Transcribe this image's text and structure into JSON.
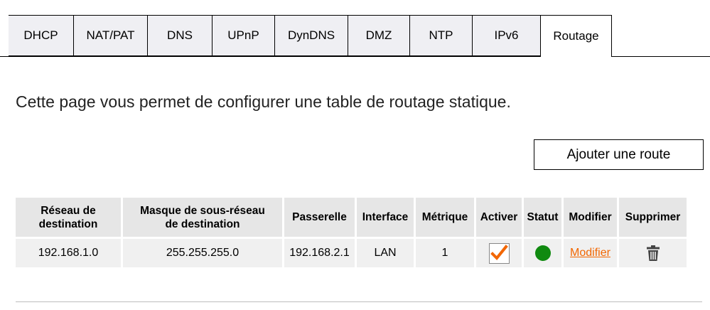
{
  "tabs": [
    {
      "label": "DHCP",
      "active": false
    },
    {
      "label": "NAT/PAT",
      "active": false
    },
    {
      "label": "DNS",
      "active": false
    },
    {
      "label": "UPnP",
      "active": false
    },
    {
      "label": "DynDNS",
      "active": false
    },
    {
      "label": "DMZ",
      "active": false
    },
    {
      "label": "NTP",
      "active": false
    },
    {
      "label": "IPv6",
      "active": false
    },
    {
      "label": "Routage",
      "active": true
    }
  ],
  "intro": "Cette page vous permet de configurer une table de routage statique.",
  "add_button_label": "Ajouter une route",
  "table": {
    "headers": {
      "dest_line1": "Réseau de",
      "dest_line2": "destination",
      "mask_line1": "Masque de sous-réseau",
      "mask_line2": "de destination",
      "gateway": "Passerelle",
      "interface": "Interface",
      "metric": "Métrique",
      "enable": "Activer",
      "status": "Statut",
      "edit": "Modifier",
      "delete": "Supprimer"
    },
    "rows": [
      {
        "destination": "192.168.1.0",
        "mask": "255.255.255.0",
        "gateway": "192.168.2.1",
        "interface": "LAN",
        "metric": "1",
        "enabled": true,
        "status": "active",
        "edit_label": "Modifier"
      }
    ]
  },
  "colors": {
    "accent": "#f26600",
    "status_ok": "#108a10",
    "header_bg": "#e6e6e6",
    "row_bg": "#f0f0f0",
    "tab_bg": "#efeff3"
  },
  "icons": {
    "check": "check-icon",
    "status": "status-dot-icon",
    "delete": "trash-icon"
  }
}
